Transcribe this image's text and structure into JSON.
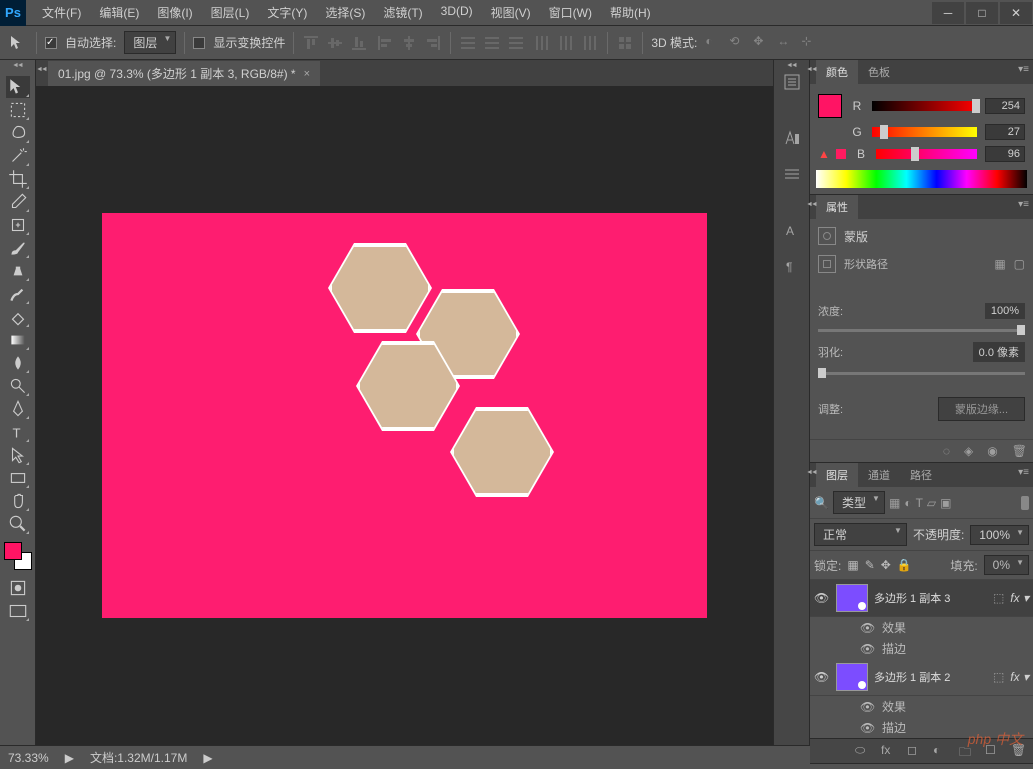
{
  "app": {
    "logo": "Ps"
  },
  "menu": {
    "file": "文件(F)",
    "edit": "编辑(E)",
    "image": "图像(I)",
    "layer": "图层(L)",
    "type": "文字(Y)",
    "select": "选择(S)",
    "filter": "滤镜(T)",
    "three_d": "3D(D)",
    "view": "视图(V)",
    "window": "窗口(W)",
    "help": "帮助(H)"
  },
  "options": {
    "auto_select": "自动选择:",
    "layer_dropdown": "图层",
    "show_transform": "显示变换控件",
    "mode_3d": "3D 模式:"
  },
  "doc": {
    "tab_title": "01.jpg @ 73.3% (多边形 1 副本 3, RGB/8#) *",
    "zoom": "73.33%",
    "file_info": "文档:1.32M/1.17M"
  },
  "color_panel": {
    "tab_color": "颜色",
    "tab_swatches": "色板",
    "r_label": "R",
    "r_value": "254",
    "g_label": "G",
    "g_value": "27",
    "b_label": "B",
    "b_value": "96"
  },
  "props_panel": {
    "tab": "属性",
    "mask_label": "蒙版",
    "shape_path": "形状路径",
    "density": "浓度:",
    "density_value": "100%",
    "feather": "羽化:",
    "feather_value": "0.0 像素",
    "adjust": "调整:",
    "mask_edge": "蒙版边缘..."
  },
  "layers_panel": {
    "tab_layers": "图层",
    "tab_channels": "通道",
    "tab_paths": "路径",
    "kind": "类型",
    "blend_mode": "正常",
    "opacity_label": "不透明度:",
    "opacity_value": "100%",
    "lock_label": "锁定:",
    "fill_label": "填充:",
    "fill_value": "0%",
    "layers": [
      {
        "name": "多边形 1 副本 3",
        "fx_label": "效果",
        "stroke_label": "描边"
      },
      {
        "name": "多边形 1 副本 2",
        "fx_label": "效果",
        "stroke_label": "描边"
      }
    ]
  },
  "statusbar": {
    "zoom": "73.33%",
    "doc": "文档:1.32M/1.17M"
  },
  "watermark": "php 中文"
}
